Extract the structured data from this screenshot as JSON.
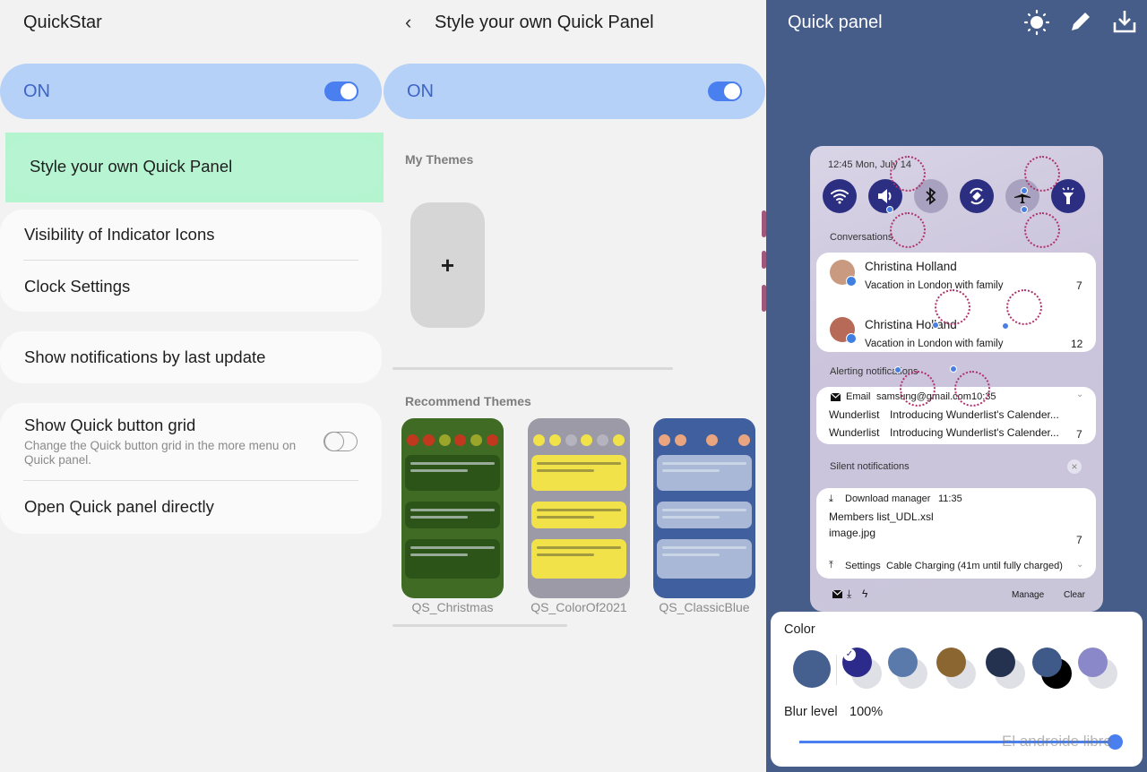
{
  "left": {
    "title": "QuickStar",
    "master_toggle": {
      "label": "ON",
      "state": true
    },
    "items": [
      {
        "label": "Style your own Quick Panel",
        "highlighted": true
      },
      {
        "label": "Visibility of Indicator Icons"
      },
      {
        "label": "Clock Settings"
      },
      {
        "label": "Show notifications by last update"
      },
      {
        "label": "Show Quick button grid",
        "sub": "Change the Quick button grid in the more menu on Quick panel.",
        "toggle": false
      },
      {
        "label": "Open Quick panel directly"
      }
    ],
    "colors": {
      "highlight": "#b4f4cf",
      "on_bar": "#b5d1f7",
      "accent": "#4a7ff0"
    }
  },
  "middle": {
    "back_icon": "chevron-left-icon",
    "title": "Style your own Quick Panel",
    "master_toggle": {
      "label": "ON",
      "state": true
    },
    "my_themes_label": "My Themes",
    "add_theme_label": "+",
    "recommend_label": "Recommend Themes",
    "themes": [
      {
        "name": "QS_Christmas",
        "bg": "#3f6b24",
        "card": "#2d5418",
        "dot": "#c0391f",
        "dot2": "#9aa52a"
      },
      {
        "name": "QS_ColorOf2021",
        "bg": "#9c9aa6",
        "card": "#f2e24a",
        "dot": "#f2e24a",
        "dot2": "#b5b3bd"
      },
      {
        "name": "QS_ClassicBlue",
        "bg": "#3f5f9e",
        "card": "#a9b8d6",
        "dot": "#e8a57f",
        "dot2": "#3f5f9e"
      }
    ]
  },
  "right": {
    "title": "Quick panel",
    "header_icons": [
      "brightness-icon",
      "edit-pencil-icon",
      "download-icon"
    ],
    "preview": {
      "clock": "12:45 Mon, July 14",
      "tiles": [
        "wifi",
        "sound",
        "bluetooth",
        "auto-rotate",
        "airplane",
        "flashlight"
      ],
      "conversations_label": "Conversations",
      "conversations": [
        {
          "name": "Christina Holland",
          "message": "Vacation in London with family",
          "count": "7"
        },
        {
          "name": "Christina Holland",
          "message": "Vacation in London with family",
          "count": "12"
        }
      ],
      "alerting_label": "Alerting notifications",
      "email": {
        "app": "Email",
        "account": "samsung@gmail.com",
        "time": "10:35"
      },
      "alerting_rows": [
        {
          "app": "Wunderlist",
          "text": "Introducing Wunderlist's Calender..."
        },
        {
          "app": "Wunderlist",
          "text": "Introducing Wunderlist's Calender...",
          "count": "7"
        }
      ],
      "silent_label": "Silent notifications",
      "download": {
        "app": "Download manager",
        "time": "11:35",
        "files": [
          "Members list_UDL.xsl",
          "image.jpg"
        ],
        "count": "7"
      },
      "settings_row": {
        "app": "Settings",
        "text": "Cable Charging (41m until fully charged)"
      },
      "manage_label": "Manage",
      "clear_label": "Clear"
    },
    "color_panel": {
      "color_label": "Color",
      "current": "#455f8f",
      "swatches": [
        {
          "color": "#2c2a8a",
          "selected": true
        },
        {
          "color": "#5a7aab"
        },
        {
          "color": "#8b6631"
        },
        {
          "color": "#24324f"
        },
        {
          "color": "#3f5a88",
          "shadow": "#000000"
        },
        {
          "color": "#8a88c8"
        }
      ],
      "blur_label": "Blur level",
      "blur_value": "100%",
      "blur_fraction": 1.0
    },
    "watermark": "El androide libre"
  }
}
